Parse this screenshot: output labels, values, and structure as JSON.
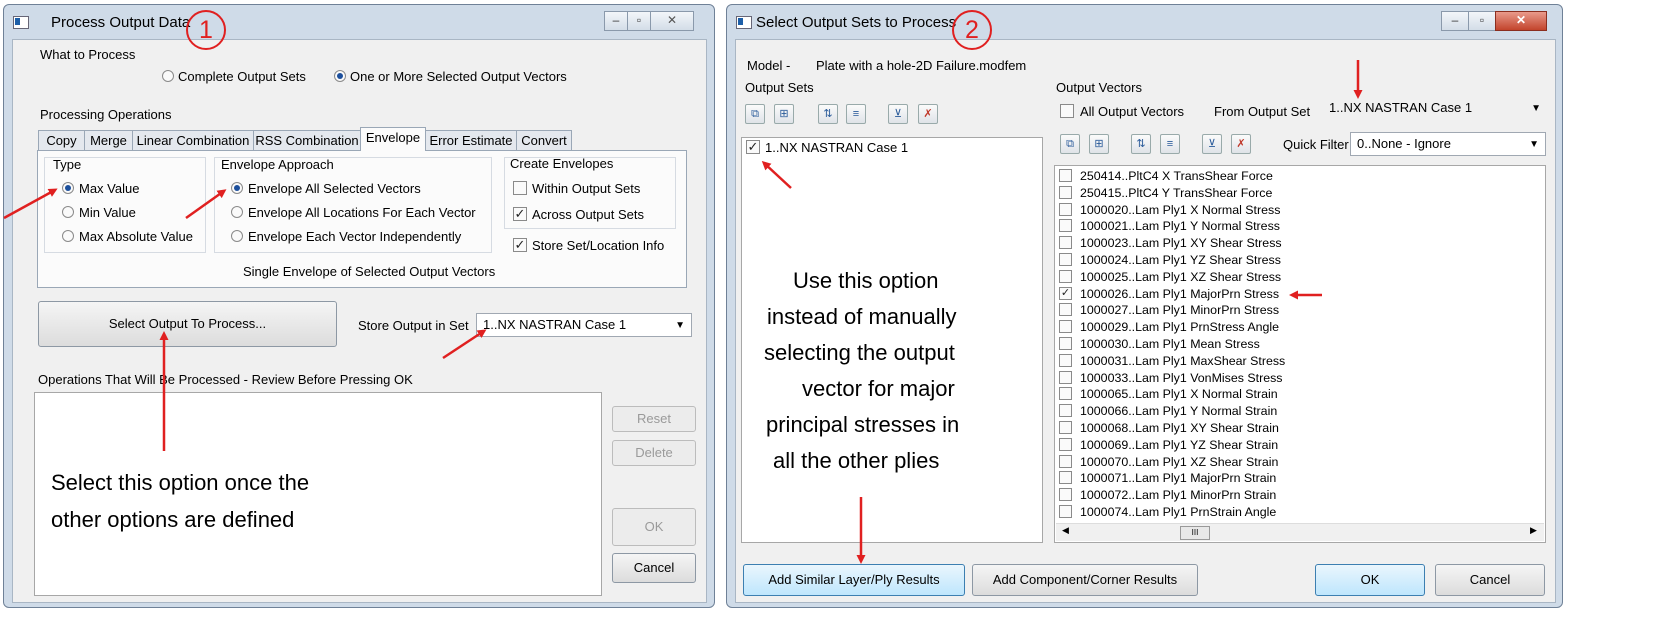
{
  "colors": {
    "annotation_red": "#e02020",
    "title_bar": "#cfdbe8",
    "panel": "#f0f0f0",
    "radio_dot": "#1c4f9c"
  },
  "left": {
    "title": "Process Output Data",
    "badge": "1",
    "what_to_process": "What to Process",
    "radio_complete": "Complete Output Sets",
    "radio_selected": "One or More Selected Output Vectors",
    "processing_ops": "Processing Operations",
    "tabs": [
      "Copy",
      "Merge",
      "Linear Combination",
      "RSS Combination",
      "Envelope",
      "Error Estimate",
      "Convert"
    ],
    "type_label": "Type",
    "type_options": [
      "Max Value",
      "Min Value",
      "Max Absolute Value"
    ],
    "approach_label": "Envelope Approach",
    "approach_options": [
      "Envelope All Selected Vectors",
      "Envelope All Locations For Each Vector",
      "Envelope Each Vector Independently"
    ],
    "create_label": "Create Envelopes",
    "within": "Within Output Sets",
    "across": "Across Output Sets",
    "store_info": "Store Set/Location Info",
    "summary": "Single Envelope of Selected Output Vectors",
    "select_output_btn": "Select Output To Process...",
    "store_label": "Store Output in Set",
    "store_value": "1..NX NASTRAN Case 1",
    "ops_label": "Operations That Will Be Processed - Review Before Pressing OK",
    "reset": "Reset",
    "delete": "Delete",
    "ok": "OK",
    "cancel": "Cancel",
    "annotation": [
      "Select this option once the",
      "other options are defined"
    ]
  },
  "right": {
    "title": "Select Output Sets to Process",
    "badge": "2",
    "model_label": "Model -",
    "model_value": "Plate with a hole-2D Failure.modfem",
    "output_sets": "Output Sets",
    "set_item": "1..NX NASTRAN Case 1",
    "output_vectors": "Output Vectors",
    "all_vectors": "All Output Vectors",
    "from_set_label": "From Output Set",
    "from_set_value": "1..NX NASTRAN Case 1",
    "quick_filter_label": "Quick Filter",
    "quick_filter_value": "0..None - Ignore",
    "vectors": [
      {
        "label": "250414..PltC4 X TransShear Force",
        "checked": false
      },
      {
        "label": "250415..PltC4 Y TransShear Force",
        "checked": false
      },
      {
        "label": "1000020..Lam Ply1 X Normal Stress",
        "checked": false
      },
      {
        "label": "1000021..Lam Ply1 Y Normal Stress",
        "checked": false
      },
      {
        "label": "1000023..Lam Ply1 XY Shear Stress",
        "checked": false
      },
      {
        "label": "1000024..Lam Ply1 YZ Shear Stress",
        "checked": false
      },
      {
        "label": "1000025..Lam Ply1 XZ Shear Stress",
        "checked": false
      },
      {
        "label": "1000026..Lam Ply1 MajorPrn Stress",
        "checked": true
      },
      {
        "label": "1000027..Lam Ply1 MinorPrn Stress",
        "checked": false
      },
      {
        "label": "1000029..Lam Ply1 PrnStress Angle",
        "checked": false
      },
      {
        "label": "1000030..Lam Ply1 Mean Stress",
        "checked": false
      },
      {
        "label": "1000031..Lam Ply1 MaxShear Stress",
        "checked": false
      },
      {
        "label": "1000033..Lam Ply1 VonMises Stress",
        "checked": false
      },
      {
        "label": "1000065..Lam Ply1 X Normal Strain",
        "checked": false
      },
      {
        "label": "1000066..Lam Ply1 Y Normal Strain",
        "checked": false
      },
      {
        "label": "1000068..Lam Ply1 XY Shear Strain",
        "checked": false
      },
      {
        "label": "1000069..Lam Ply1 YZ Shear Strain",
        "checked": false
      },
      {
        "label": "1000070..Lam Ply1 XZ Shear Strain",
        "checked": false
      },
      {
        "label": "1000071..Lam Ply1 MajorPrn Strain",
        "checked": false
      },
      {
        "label": "1000072..Lam Ply1 MinorPrn Strain",
        "checked": false
      },
      {
        "label": "1000074..Lam Ply1 PrnStrain Angle",
        "checked": false
      }
    ],
    "scroll_thumb": "III",
    "add_similar": "Add Similar Layer/Ply Results",
    "add_component": "Add Component/Corner Results",
    "ok": "OK",
    "cancel": "Cancel",
    "annotation": [
      "Use this option",
      "instead of manually",
      "selecting the output",
      "vector for major",
      "principal stresses in",
      "all the other plies"
    ]
  }
}
